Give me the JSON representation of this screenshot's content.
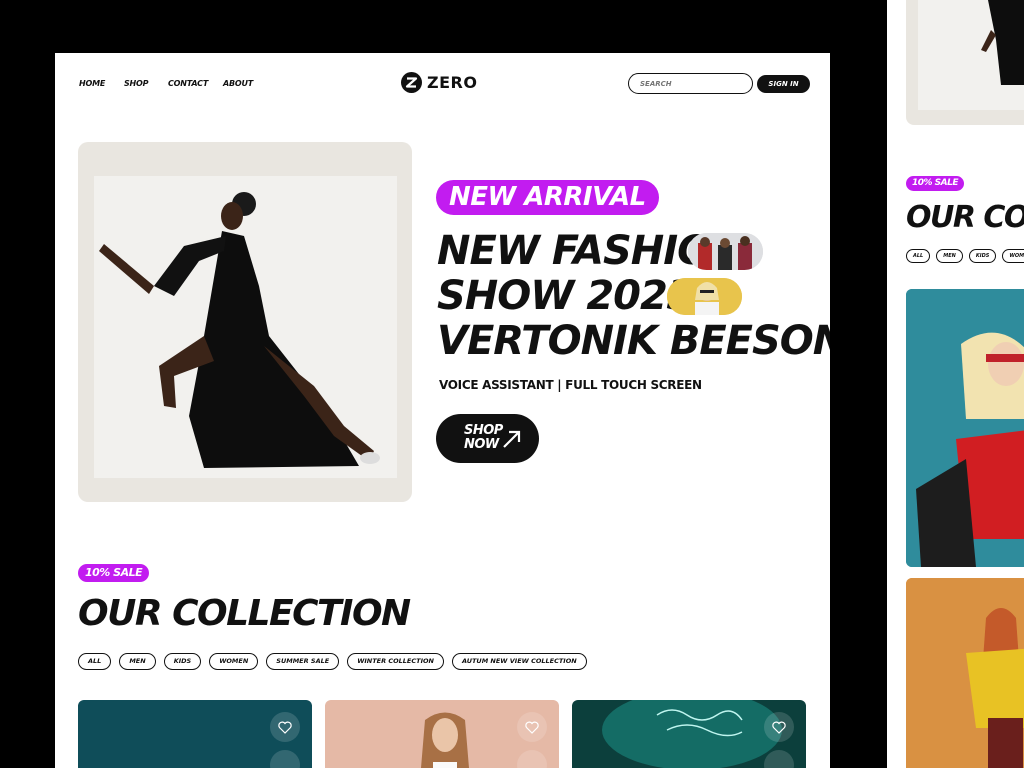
{
  "nav": {
    "links": [
      "HOME",
      "SHOP",
      "CONTACT",
      "ABOUT"
    ],
    "logo_text": "ZERO",
    "search_placeholder": "SEARCH",
    "signin_label": "SIGN IN"
  },
  "hero": {
    "badge": "NEW ARRIVAL",
    "headline_lines": [
      "NEW FASHION",
      "SHOW 2023",
      "VERTONIK BEESON."
    ],
    "subtitle": "VOICE ASSISTANT | FULL TOUCH SCREEN",
    "cta_label": "SHOP NOW"
  },
  "collection": {
    "badge": "10% SALE",
    "title": "OUR COLLECTION",
    "filters": [
      "ALL",
      "MEN",
      "KIDS",
      "WOMEN",
      "SUMMER SALE",
      "WINTER COLLECTION",
      "AUTUM NEW VIEW COLLECTION"
    ]
  },
  "side_preview": {
    "badge": "10% SALE",
    "title": "OUR COLL",
    "filters": [
      "ALL",
      "MEN",
      "KIDS",
      "WOME"
    ]
  },
  "colors": {
    "accent": "#c21cf0",
    "dark": "#111111",
    "hero_bg": "#e9e6e0"
  },
  "icons": [
    "logo-mark-icon",
    "arrow-up-right-icon",
    "heart-icon",
    "bag-icon"
  ]
}
